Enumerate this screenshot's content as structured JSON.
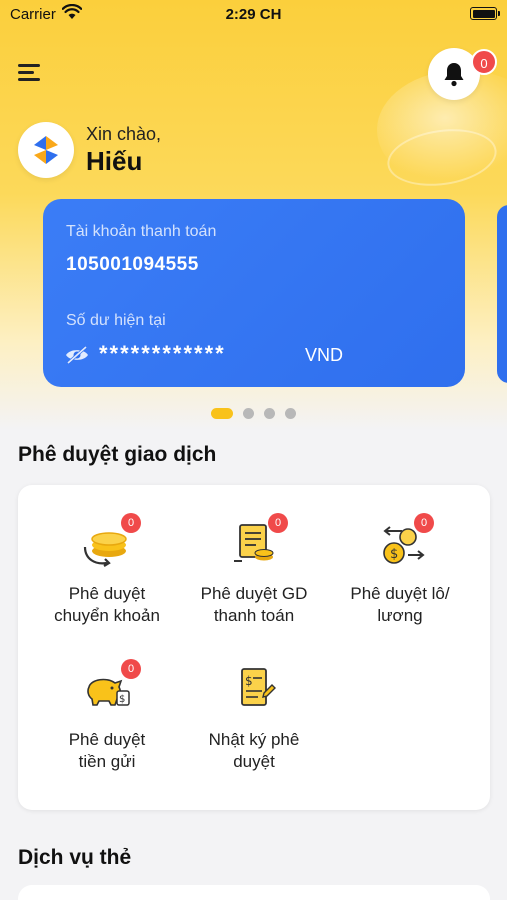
{
  "status_bar": {
    "carrier": "Carrier",
    "time": "2:29 CH"
  },
  "header": {
    "notification_count": "0",
    "greeting": "Xin chào,",
    "user_name": "Hiếu"
  },
  "account_card": {
    "label": "Tài khoản thanh toán",
    "account_number": "105001094555",
    "balance_label": "Số dư hiện tại",
    "balance_masked": "************",
    "currency": "VND"
  },
  "carousel": {
    "active_index": 0,
    "dot_count": 4
  },
  "approval_section": {
    "title": "Phê duyệt giao dịch",
    "items": [
      {
        "label": "Phê duyệt\nchuyển khoản",
        "badge": "0",
        "icon": "coin-transfer-icon"
      },
      {
        "label": "Phê duyệt GD\nthanh toán",
        "badge": "0",
        "icon": "payment-document-icon"
      },
      {
        "label": "Phê duyệt lô/\nlương",
        "badge": "0",
        "icon": "batch-salary-icon"
      },
      {
        "label": "Phê duyệt\ntiền gửi",
        "badge": "0",
        "icon": "deposit-piggy-icon"
      },
      {
        "label": "Nhật ký phê\nduyệt",
        "icon": "approval-log-icon"
      }
    ]
  },
  "card_services_section": {
    "title": "Dịch vụ thẻ"
  },
  "colors": {
    "accent_yellow": "#f9c21a",
    "card_blue": "#2f6fee",
    "badge_red": "#f04a4a"
  }
}
